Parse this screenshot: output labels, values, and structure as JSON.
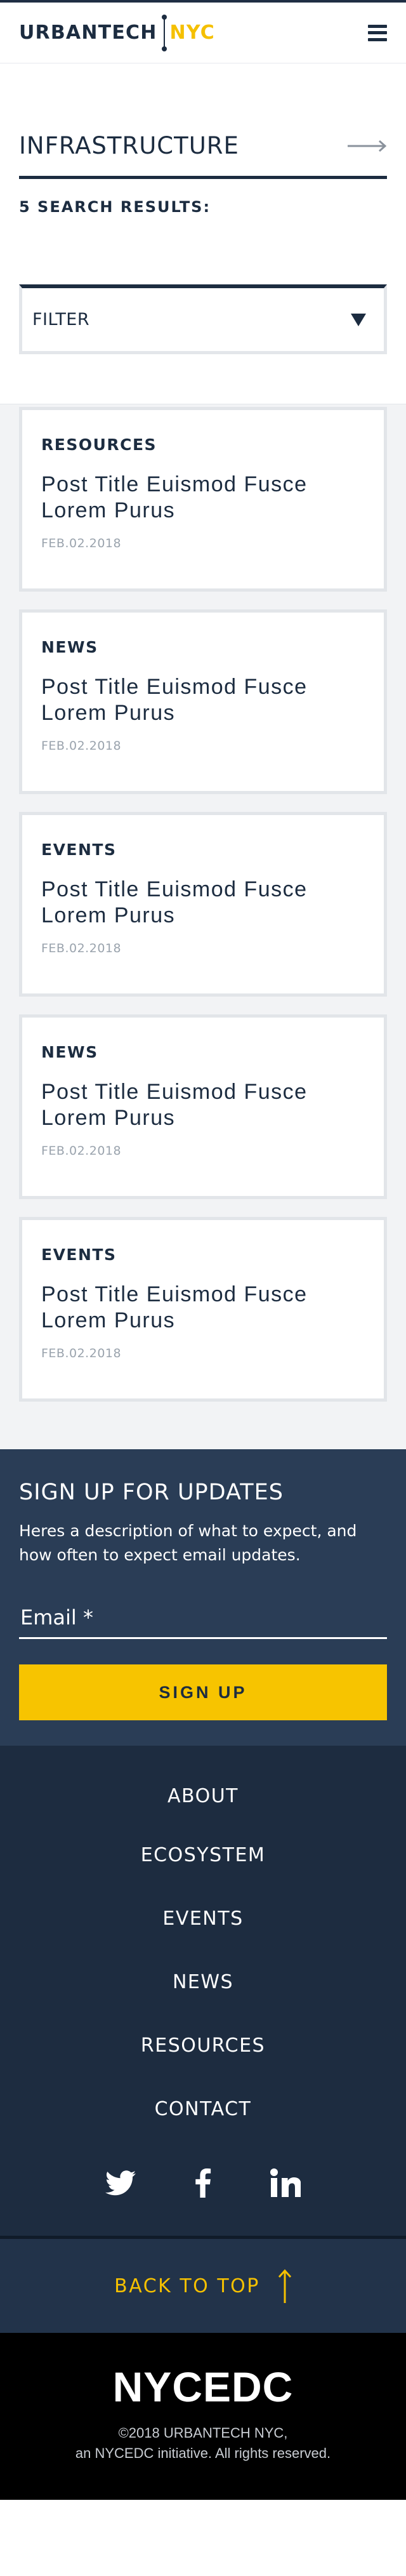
{
  "header": {
    "logo_primary": "URBANTECH",
    "logo_secondary": "NYC",
    "menu_icon": "hamburger-menu-icon",
    "colors": {
      "navy": "#1c2c40",
      "accent": "#f5c000"
    }
  },
  "topic": {
    "title": "INFRASTRUCTURE",
    "arrow_icon": "arrow-right-icon"
  },
  "results": {
    "count_label": "5 SEARCH RESULTS:"
  },
  "filter": {
    "label": "FILTER",
    "caret_icon": "caret-down-icon"
  },
  "cards": [
    {
      "category": "RESOURCES",
      "title": "Post Title Euismod Fusce Lorem Purus",
      "date": "FEB.02.2018"
    },
    {
      "category": "NEWS",
      "title": "Post Title Euismod Fusce Lorem Purus",
      "date": "FEB.02.2018"
    },
    {
      "category": "EVENTS",
      "title": "Post Title Euismod Fusce Lorem Purus",
      "date": "FEB.02.2018"
    },
    {
      "category": "NEWS",
      "title": "Post Title Euismod Fusce Lorem Purus",
      "date": "FEB.02.2018"
    },
    {
      "category": "EVENTS",
      "title": "Post Title Euismod Fusce Lorem Purus",
      "date": "FEB.02.2018"
    }
  ],
  "signup": {
    "title": "SIGN UP FOR UPDATES",
    "description": "Heres a description of what to expect, and how often to expect email updates.",
    "email_placeholder": "Email *",
    "email_value": "",
    "button_label": "SIGN UP"
  },
  "footer_nav": {
    "links": [
      {
        "label": "ABOUT"
      },
      {
        "label": "ECOSYSTEM"
      },
      {
        "label": "EVENTS"
      },
      {
        "label": "NEWS"
      },
      {
        "label": "RESOURCES"
      },
      {
        "label": "CONTACT"
      }
    ],
    "social_icons": [
      "twitter-icon",
      "facebook-icon",
      "linkedin-icon"
    ]
  },
  "back_to_top": {
    "label": "BACK TO TOP",
    "icon": "arrow-up-icon"
  },
  "bottom_footer": {
    "logo": "NYCEDC",
    "copyright_line1": "©2018 URBANTECH NYC,",
    "copyright_line2": "an NYCEDC initiative. All rights reserved."
  }
}
